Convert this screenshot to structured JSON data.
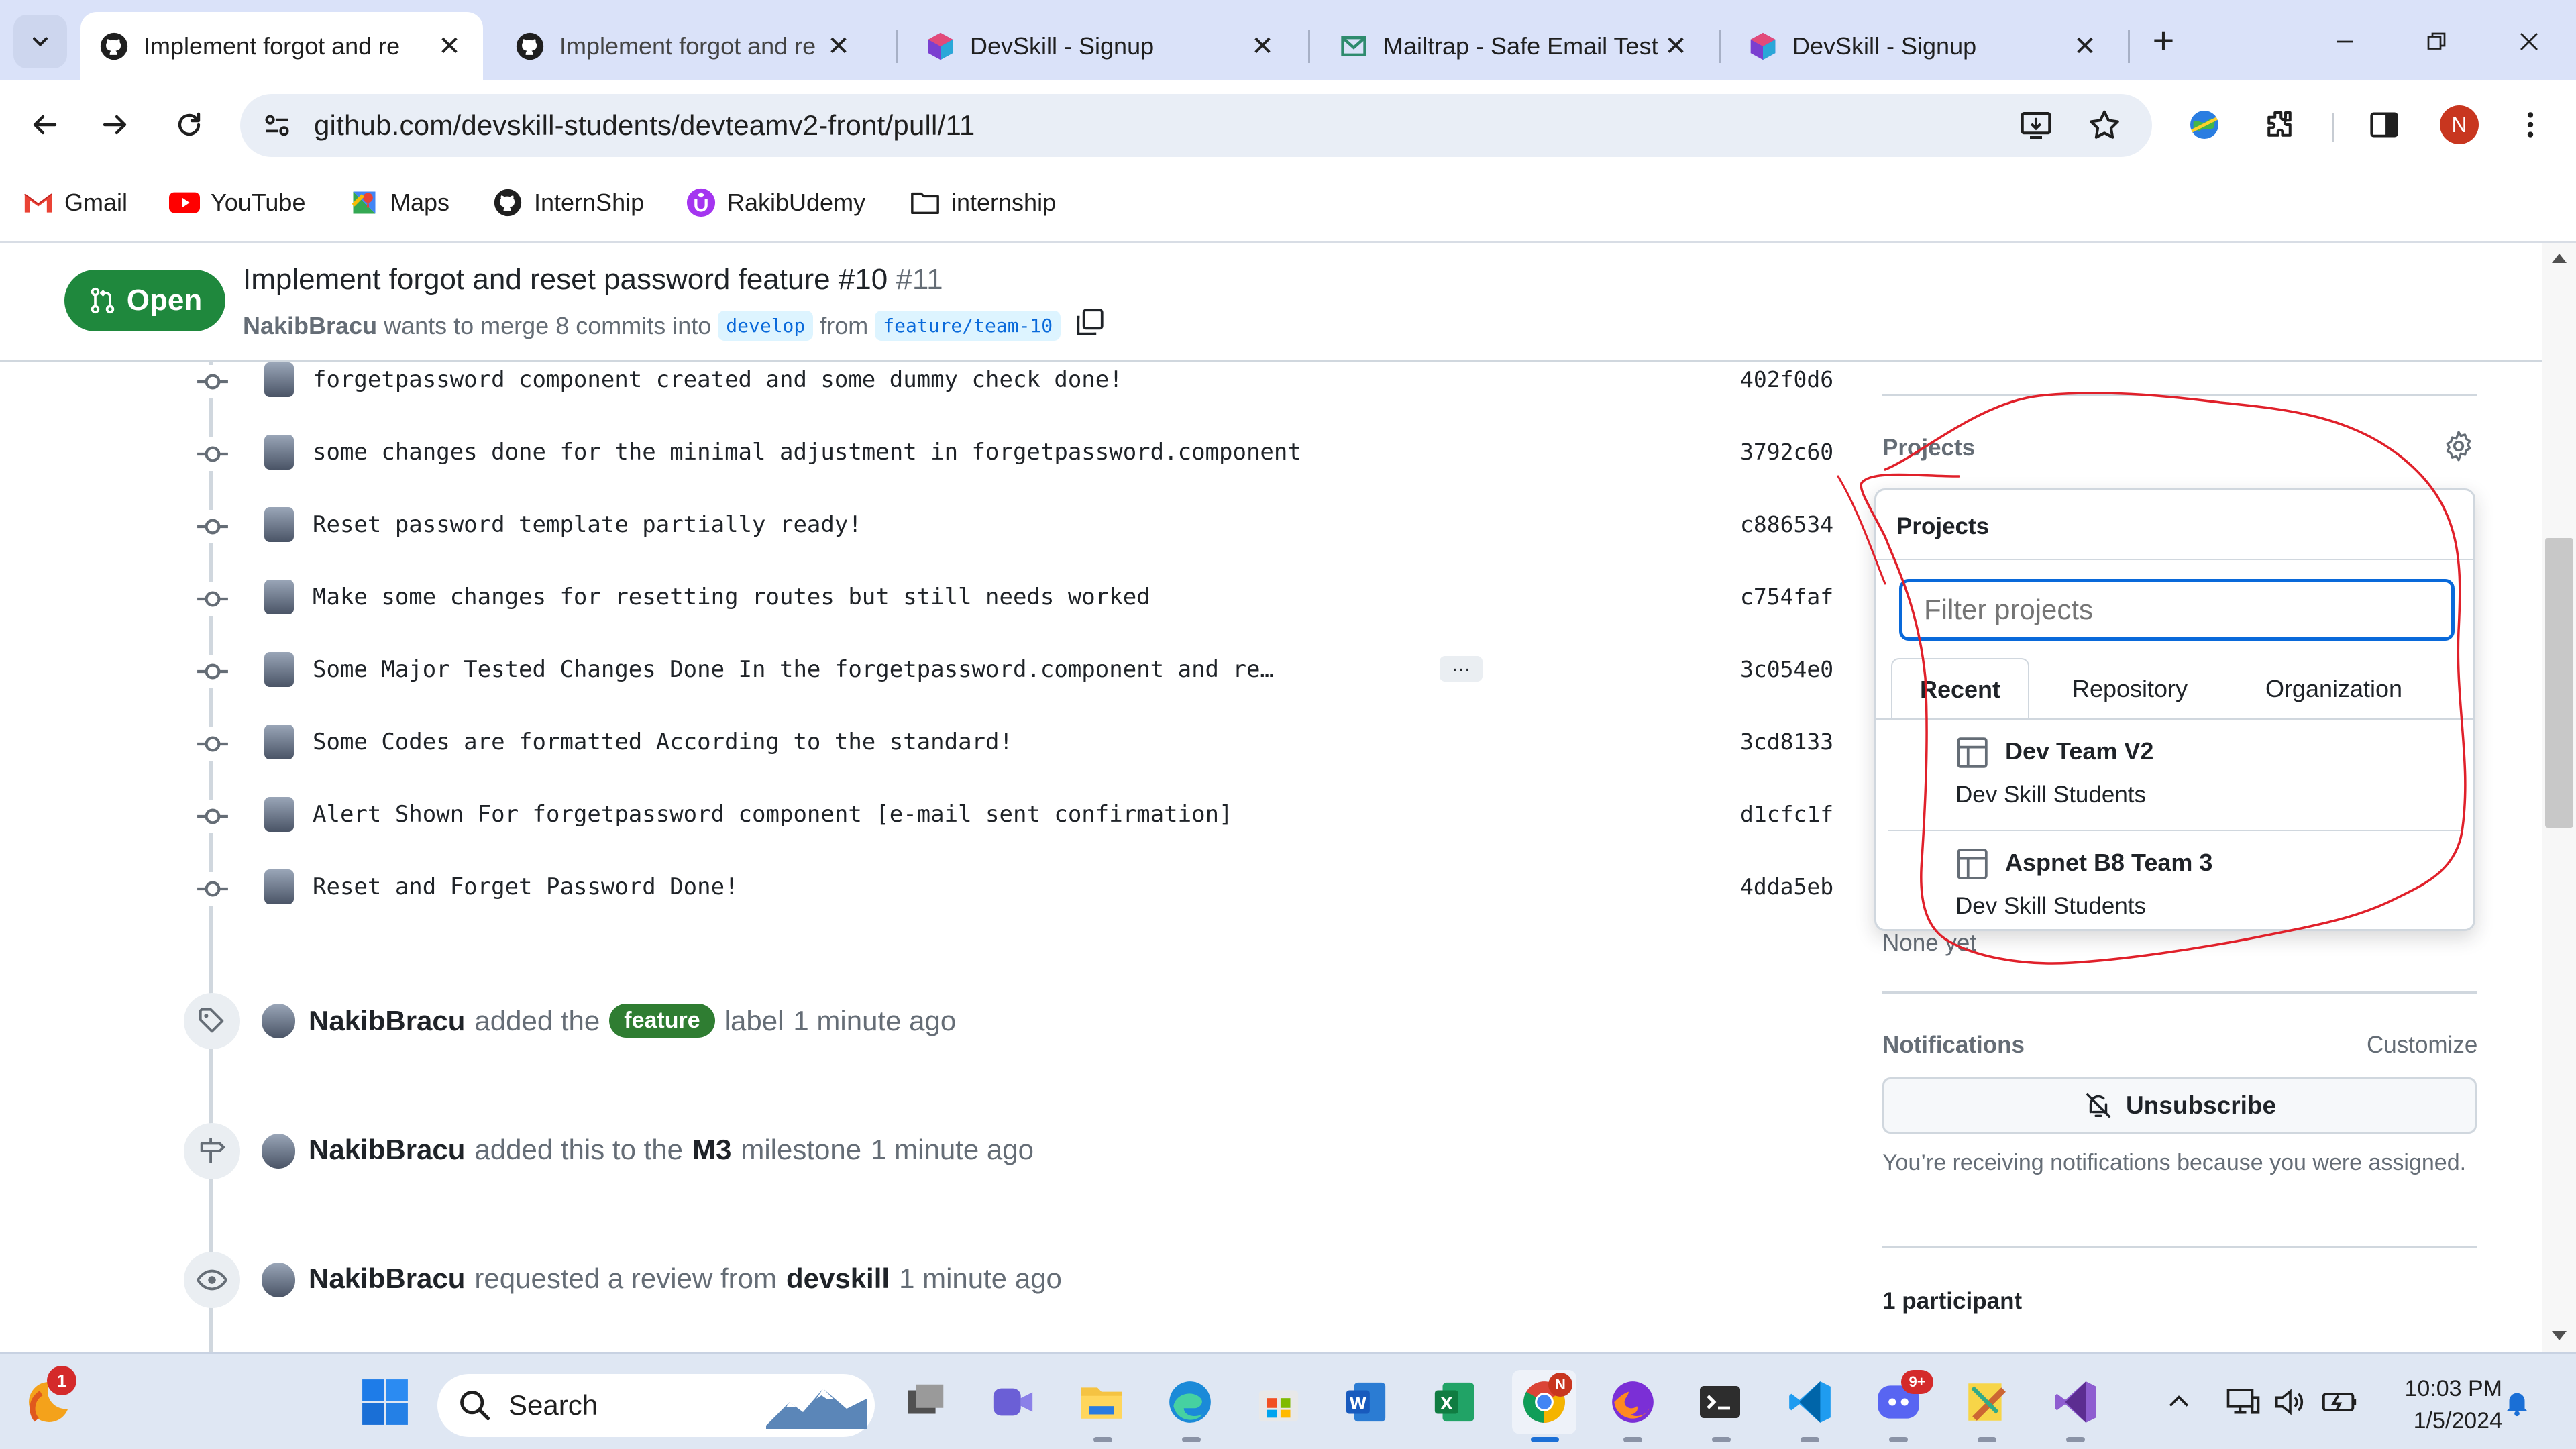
{
  "tabs": [
    {
      "title": "Implement forgot and re",
      "icon": "github-icon",
      "active": true
    },
    {
      "title": "Implement forgot and re",
      "icon": "github-icon",
      "active": false
    },
    {
      "title": "DevSkill - Signup",
      "icon": "devskill-icon",
      "active": false
    },
    {
      "title": "Mailtrap - Safe Email Test",
      "icon": "mailtrap-icon",
      "active": false
    },
    {
      "title": "DevSkill - Signup",
      "icon": "devskill-icon",
      "active": false
    }
  ],
  "address": {
    "url": "github.com/devskill-students/devteamv2-front/pull/11"
  },
  "profile": {
    "initial": "N"
  },
  "bookmarks": [
    {
      "label": "Gmail",
      "icon": "gmail-icon"
    },
    {
      "label": "YouTube",
      "icon": "youtube-icon"
    },
    {
      "label": "Maps",
      "icon": "maps-icon"
    },
    {
      "label": "InternShip",
      "icon": "github-icon"
    },
    {
      "label": "RakibUdemy",
      "icon": "udemy-icon"
    },
    {
      "label": "internship",
      "icon": "folder-icon"
    }
  ],
  "pr": {
    "state": "Open",
    "title": "Implement forgot and reset password feature #10",
    "number": "#11",
    "author": "NakibBracu",
    "merge_text": "wants to merge 8 commits into",
    "base": "develop",
    "from_word": "from",
    "head": "feature/team-10"
  },
  "commits": [
    {
      "msg": "forgetpassword component created and some dummy check done!",
      "sha": "402f0d6"
    },
    {
      "msg": "some changes done for the minimal adjustment in forgetpassword.component",
      "sha": "3792c60"
    },
    {
      "msg": "Reset password template partially ready!",
      "sha": "c886534"
    },
    {
      "msg": "Make some changes for resetting routes but still needs worked",
      "sha": "c754faf"
    },
    {
      "msg": "Some Major Tested Changes Done In the forgetpassword.component and re…",
      "sha": "3c054e0"
    },
    {
      "msg": "Some Codes are formatted According to the standard!",
      "sha": "3cd8133"
    },
    {
      "msg": "Alert Shown For forgetpassword component [e-mail sent confirmation]",
      "sha": "d1cfc1f"
    },
    {
      "msg": "Reset and Forget Password Done!",
      "sha": "4dda5eb"
    }
  ],
  "commit_more": "…",
  "events": {
    "label": {
      "actor": "NakibBracu",
      "pre": "added the",
      "label": "feature",
      "post": "label",
      "time": "1 minute ago"
    },
    "milestone": {
      "actor": "NakibBracu",
      "pre": "added this to the",
      "milestone": "M3",
      "post": "milestone",
      "time": "1 minute ago"
    },
    "review": {
      "actor": "NakibBracu",
      "pre": "requested a review from",
      "reviewer": "devskill",
      "time": "1 minute ago"
    }
  },
  "sidebar": {
    "projects_heading": "Projects",
    "projects_value": "None yet",
    "notifications_heading": "Notifications",
    "customize": "Customize",
    "unsubscribe": "Unsubscribe",
    "notif_reason": "You’re receiving notifications because you were assigned.",
    "participants": "1 participant"
  },
  "project_popup": {
    "title": "Projects",
    "filter_placeholder": "Filter projects",
    "tabs": [
      "Recent",
      "Repository",
      "Organization"
    ],
    "items": [
      {
        "name": "Dev Team V2",
        "owner": "Dev Skill Students"
      },
      {
        "name": "Aspnet B8 Team 3",
        "owner": "Dev Skill Students"
      }
    ]
  },
  "taskbar": {
    "search_placeholder": "Search",
    "time": "10:03 PM",
    "date": "1/5/2024",
    "weather_badge": "1",
    "discord_badge": "9+"
  },
  "colors": {
    "accent": "#0969da",
    "open_green": "#1f883d",
    "annotation_red": "#e0202a"
  }
}
